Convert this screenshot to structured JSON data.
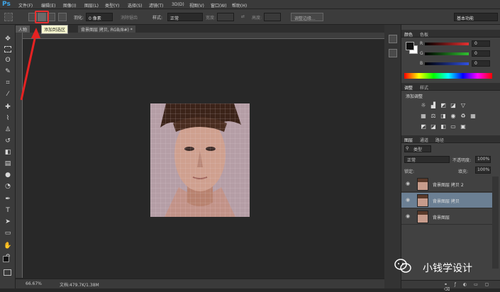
{
  "app": {
    "logo": "Ps"
  },
  "menu": [
    "文件(F)",
    "编辑(E)",
    "图像(I)",
    "图层(L)",
    "类型(Y)",
    "选择(S)",
    "滤镜(T)",
    "3D(D)",
    "视图(V)",
    "窗口(W)",
    "帮助(H)"
  ],
  "options": {
    "feather_label": "羽化:",
    "feather_value": "0 像素",
    "antialias_label": "消除锯齿",
    "style_label": "样式:",
    "style_value": "正常",
    "width_label": "宽度:",
    "height_label": "高度:",
    "refine_label": "调整边缘...",
    "workspace": "基本功能",
    "tooltip": "添加到选区"
  },
  "document": {
    "tab1": "人物",
    "tab2": "背景图层 拷贝, RGB/8#) *",
    "zoom": "66.67%",
    "doc_info": "文档:479.7K/1.38M"
  },
  "panels": {
    "color_tabs": [
      "颜色",
      "色板"
    ],
    "channels": [
      {
        "label": "R",
        "value": "0",
        "gradient": "#e53030"
      },
      {
        "label": "G",
        "value": "0",
        "gradient": "#30c030"
      },
      {
        "label": "B",
        "value": "0",
        "gradient": "#3050e0"
      }
    ],
    "adjust_tabs": [
      "调整",
      "样式"
    ],
    "adjust_title": "添加调整",
    "layers_tabs": [
      "图层",
      "通道",
      "路径"
    ],
    "kind_label": "类型",
    "blend_mode": "正常",
    "opacity_label": "不透明度:",
    "opacity_value": "100%",
    "lock_label": "锁定:",
    "fill_label": "填充:",
    "fill_value": "100%",
    "layers": [
      {
        "name": "背景图层 拷贝 2",
        "selected": false
      },
      {
        "name": "背景图层 拷贝",
        "selected": true
      },
      {
        "name": "背景图层",
        "selected": false
      }
    ]
  },
  "watermark": {
    "text": "小钱学设计"
  }
}
